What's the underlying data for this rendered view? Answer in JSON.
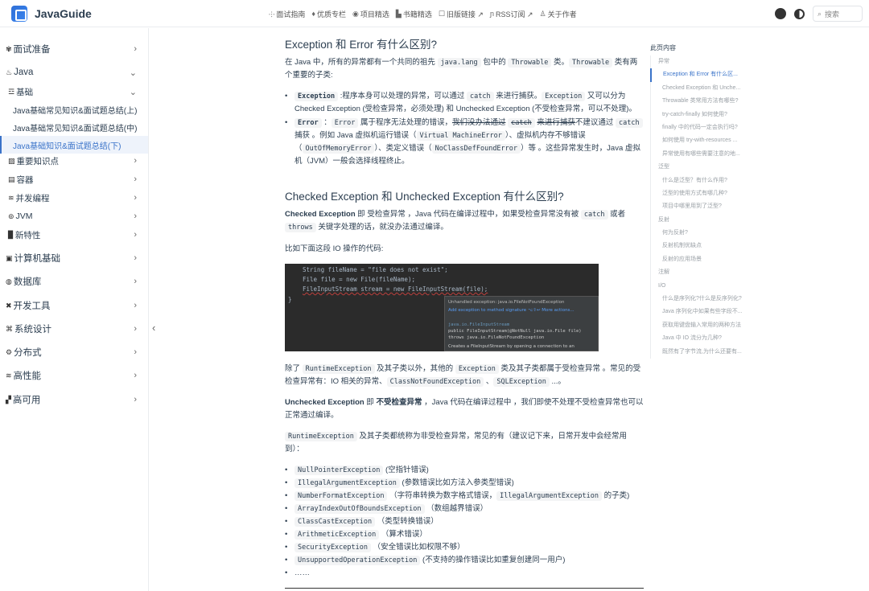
{
  "navbar": {
    "brand": "JavaGuide",
    "links": [
      {
        "icon": "⸭",
        "label": "面试指南"
      },
      {
        "icon": "♦",
        "label": "优质专栏"
      },
      {
        "icon": "◉",
        "label": "项目精选"
      },
      {
        "icon": "▙",
        "label": "书籍精选"
      },
      {
        "icon": "☐",
        "label": "旧版链接 ↗"
      },
      {
        "icon": "ɲ",
        "label": "RSS订阅 ↗"
      },
      {
        "icon": "♙",
        "label": "关于作者"
      }
    ],
    "search_placeholder": "搜索"
  },
  "sidebar": {
    "items": [
      {
        "label": "面试准备",
        "icon": "✾"
      },
      {
        "label": "Java",
        "icon": "♨"
      },
      {
        "label": "基础",
        "icon": "☲"
      },
      {
        "label": "Java基础常见知识&面试题总结(上)"
      },
      {
        "label": "Java基础常见知识&面试题总结(中)"
      },
      {
        "label": "Java基础知识&面试题总结(下)"
      },
      {
        "label": "重要知识点",
        "icon": "▨"
      },
      {
        "label": "容器",
        "icon": "▤"
      },
      {
        "label": "并发编程",
        "icon": "≋"
      },
      {
        "label": "JVM",
        "icon": "⊚"
      },
      {
        "label": "新特性",
        "icon": "▉"
      },
      {
        "label": "计算机基础",
        "icon": "▣"
      },
      {
        "label": "数据库",
        "icon": "◍"
      },
      {
        "label": "开发工具",
        "icon": "✖"
      },
      {
        "label": "系统设计",
        "icon": "⌘"
      },
      {
        "label": "分布式",
        "icon": "⚙"
      },
      {
        "label": "高性能",
        "icon": "≋"
      },
      {
        "label": "高可用",
        "icon": "▞"
      }
    ]
  },
  "article": {
    "h_exception_error": "Exception 和 Error 有什么区别?",
    "p1_a": "在 Java 中，所有的异常都有一个共同的祖先 ",
    "p1_code1": "java.lang",
    "p1_b": " 包中的 ",
    "p1_code2": "Throwable",
    "p1_c": " 类。",
    "p1_code3": "Throwable",
    "p1_d": " 类有两个重要的子类:",
    "li1_code": "Exception",
    "li1_a": " :程序本身可以处理的异常，可以通过 ",
    "li1_code2": "catch",
    "li1_b": " 来进行捕获。",
    "li1_code3": "Exception",
    "li1_c": " 又可以分为 Checked Exception (受检查异常，必须处理) 和 Unchecked Exception (不受检查异常，可以不处理)。",
    "li2_code": "Error",
    "li2_a": " ：",
    "li2_code2": "Error",
    "li2_b": " 属于程序无法处理的错误，",
    "li2_strike1": "我们没办法通过",
    "li2_strike_code": "catch",
    "li2_strike2": "来进行捕获",
    "li2_c": "不建议通过 ",
    "li2_code3": "catch",
    "li2_d": " 捕获 。例如 Java 虚拟机运行错误（",
    "li2_code4": "Virtual MachineError",
    "li2_e": "）、虚拟机内存不够错误（",
    "li2_code5": "OutOfMemoryError",
    "li2_f": "）、类定义错误（",
    "li2_code6": "NoClassDefFoundError",
    "li2_g": "）等 。这些异常发生时，Java 虚拟机（JVM）一般会选择线程终止。",
    "h_checked": "Checked Exception 和 Unchecked Exception 有什么区别?",
    "p2_b": "Checked Exception",
    "p2_a": " 即 受检查异常 ，Java 代码在编译过程中，如果受检查异常没有被 ",
    "p2_code1": "catch",
    "p2_c": " 或者 ",
    "p2_code2": "throws",
    "p2_d": " 关键字处理的话，就没办法通过编译。",
    "p3": "比如下面这段 IO 操作的代码:",
    "code_lines": [
      "String fileName = \"file does not exist\";",
      "File file = new File(fileName);",
      "FileInputStream stream = new FileInputStream(file);",
      "}"
    ],
    "popup_lines": [
      "Unhandled exception: java.io.FileNotFoundException",
      "Add exception to method signature  ⌥⇧↩    More actions...",
      "java.io.FileInputStream",
      "public FileInputStream(@NotNull java.io.File file)",
      "throws java.io.FileNotFoundException",
      "Creates a FileInputStream by opening a connection to an"
    ],
    "p4_a": "除了 ",
    "p4_code1": "RuntimeException",
    "p4_b": " 及其子类以外，其他的 ",
    "p4_code2": "Exception",
    "p4_c": " 类及其子类都属于受检查异常 。常见的受检查异常有：IO 相关的异常、",
    "p4_code3": "ClassNotFoundException",
    "p4_d": " 、",
    "p4_code4": "SQLException",
    "p4_e": " ...。",
    "p5_b": "Unchecked Exception",
    "p5_a": " 即 ",
    "p5_b2": "不受检查异常",
    "p5_c": " ，Java 代码在编译过程中 ，我们即使不处理不受检查异常也可以正常通过编译。",
    "p6_code": "RuntimeException",
    "p6_a": " 及其子类都统称为非受检查异常，常见的有（建议记下来，日常开发中会经常用到）：",
    "runtime_list": [
      {
        "code": "NullPointerException",
        "desc": "(空指针错误)"
      },
      {
        "code": "IllegalArgumentException",
        "desc": "(参数错误比如方法入参类型错误)"
      },
      {
        "code": "NumberFormatException",
        "desc": "（字符串转换为数字格式错误，"
      },
      {
        "code": "ArrayIndexOutOfBoundsException",
        "desc": "（数组越界错误）"
      },
      {
        "code": "ClassCastException",
        "desc": "（类型转换错误）"
      },
      {
        "code": "ArithmeticException",
        "desc": "（算术错误）"
      },
      {
        "code": "SecurityException",
        "desc": "（安全错误比如权限不够）"
      },
      {
        "code": "UnsupportedOperationException",
        "desc": "(不支持的操作错误比如重复创建同一用户)"
      }
    ],
    "nfe_extra_code": "IllegalArgumentException",
    "nfe_extra_text": " 的子类)",
    "ellipsis": "……"
  },
  "toc": {
    "title": "此页内容",
    "items": [
      {
        "label": "异常",
        "level": 2
      },
      {
        "label": "Exception 和 Error 有什么区...",
        "level": 3,
        "active": true
      },
      {
        "label": "Checked Exception 和 Unche...",
        "level": 3
      },
      {
        "label": "Throwable 类常用方法有哪些?",
        "level": 3
      },
      {
        "label": "try-catch-finally 如何使用?",
        "level": 3
      },
      {
        "label": "finally 中的代码一定会执行吗?",
        "level": 3
      },
      {
        "label": "如何使用 try-with-resources ...",
        "level": 3
      },
      {
        "label": "异常使用有哪些需要注意的地...",
        "level": 3
      },
      {
        "label": "泛型",
        "level": 2
      },
      {
        "label": "什么是泛型？有什么作用?",
        "level": 3
      },
      {
        "label": "泛型的使用方式有哪几种?",
        "level": 3
      },
      {
        "label": "项目中哪里用到了泛型?",
        "level": 3
      },
      {
        "label": "反射",
        "level": 2
      },
      {
        "label": "何为反射?",
        "level": 3
      },
      {
        "label": "反射机制优缺点",
        "level": 3
      },
      {
        "label": "反射的应用场景",
        "level": 3
      },
      {
        "label": "注解",
        "level": 2
      },
      {
        "label": "I/O",
        "level": 2
      },
      {
        "label": "什么是序列化?什么是反序列化?",
        "level": 3
      },
      {
        "label": "Java 序列化中如果有些字段不...",
        "level": 3
      },
      {
        "label": "获取用键盘输入常用的两种方法",
        "level": 3
      },
      {
        "label": "Java 中 IO 流分为几种?",
        "level": 3
      },
      {
        "label": "既然有了字节流,为什么还要有...",
        "level": 3
      }
    ]
  }
}
